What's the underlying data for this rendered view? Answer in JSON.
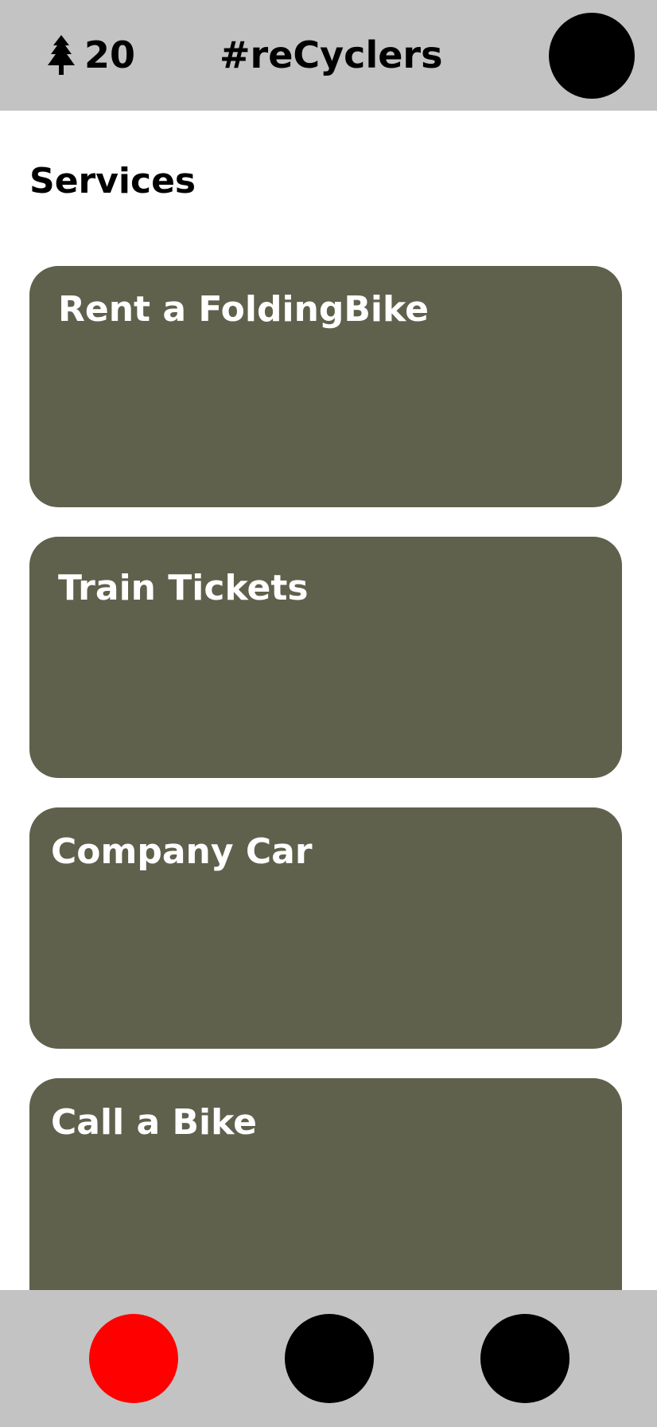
{
  "header": {
    "tree_icon": "tree-icon",
    "tree_count": "20",
    "title": "#reCyclers",
    "avatar_color": "#000000"
  },
  "main": {
    "section_title": "Services",
    "cards": [
      {
        "title": "Rent a FoldingBike"
      },
      {
        "title": "Train Tickets"
      },
      {
        "title": "Company Car"
      },
      {
        "title": "Call a Bike"
      }
    ],
    "card_color": "#5f614c"
  },
  "bottom_nav": {
    "background": "#c3c3c3",
    "buttons": [
      {
        "icon": "nav-circle-icon",
        "color": "#ff0000",
        "active": true
      },
      {
        "icon": "nav-circle-icon",
        "color": "#000000",
        "active": false
      },
      {
        "icon": "nav-circle-icon",
        "color": "#000000",
        "active": false
      }
    ]
  }
}
